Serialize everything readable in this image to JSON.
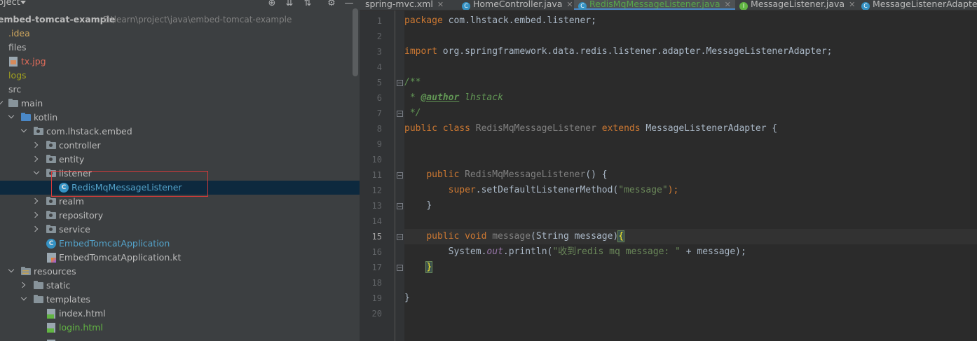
{
  "project_panel": {
    "title": "oject",
    "header_icons": [
      "crosshair-icon",
      "collapse-all-icon",
      "expand-all-icon",
      "gear-icon",
      "minimize-icon"
    ]
  },
  "tree": [
    {
      "name": "embed-tomcat-example",
      "path": "E:\\learn\\project\\java\\embed-tomcat-example"
    },
    {
      "name": ".idea"
    },
    {
      "name": "files"
    },
    {
      "name": "tx.jpg"
    },
    {
      "name": "logs"
    },
    {
      "name": "src"
    },
    {
      "name": "main"
    },
    {
      "name": "kotlin"
    },
    {
      "name": "com.lhstack.embed"
    },
    {
      "name": "controller"
    },
    {
      "name": "entity"
    },
    {
      "name": "listener"
    },
    {
      "name": "RedisMqMessageListener"
    },
    {
      "name": "realm"
    },
    {
      "name": "repository"
    },
    {
      "name": "service"
    },
    {
      "name": "EmbedTomcatApplication"
    },
    {
      "name": "EmbedTomcatApplication.kt"
    },
    {
      "name": "resources"
    },
    {
      "name": "static"
    },
    {
      "name": "templates"
    },
    {
      "name": "index.html"
    },
    {
      "name": "login.html"
    }
  ],
  "tabs": [
    {
      "label": "spring-mvc.xml",
      "active": false
    },
    {
      "label": "HomeController.java",
      "active": false
    },
    {
      "label": "RedisMqMessageListener.java",
      "active": true
    },
    {
      "label": "MessageListener.java",
      "active": false
    },
    {
      "label": "MessageListenerAdapter",
      "active": false
    }
  ],
  "editor": {
    "current_line": 15,
    "line_numbers": [
      "1",
      "2",
      "3",
      "4",
      "5",
      "6",
      "7",
      "8",
      "9",
      "10",
      "11",
      "12",
      "13",
      "14",
      "15",
      "16",
      "17",
      "18",
      "19",
      "20"
    ],
    "code": {
      "l1_kw": "package",
      "l1_rest": " com.lhstack.embed.listener;",
      "l3_kw": "import",
      "l3_rest": " org.springframework.data.redis.listener.adapter.MessageListenerAdapter;",
      "l5": "/**",
      "l6_star": " * ",
      "l6_tag": "@author",
      "l6_rest": " lhstack",
      "l7": " */",
      "l8_kw1": "public class",
      "l8_name": "RedisMqMessageListener",
      "l8_kw2": "extends",
      "l8_rest": "MessageListenerAdapter {",
      "l11_kw": "public",
      "l11_name": "RedisMqMessageListener",
      "l11_rest": "() {",
      "l12_kw": "super",
      "l12_call": ".setDefaultListenerMethod(",
      "l12_str": "\"message\"",
      "l12_end": ");",
      "l13": "}",
      "l15_kw": "public void",
      "l15_name": "message",
      "l15_rest": "(String message)",
      "l15_brace": "{",
      "l16_a": "System.",
      "l16_field": "out",
      "l16_b": ".println(",
      "l16_str": "\"收到redis mq message: \"",
      "l16_c": " + message);",
      "l17_brace": "}",
      "l19": "}"
    }
  }
}
